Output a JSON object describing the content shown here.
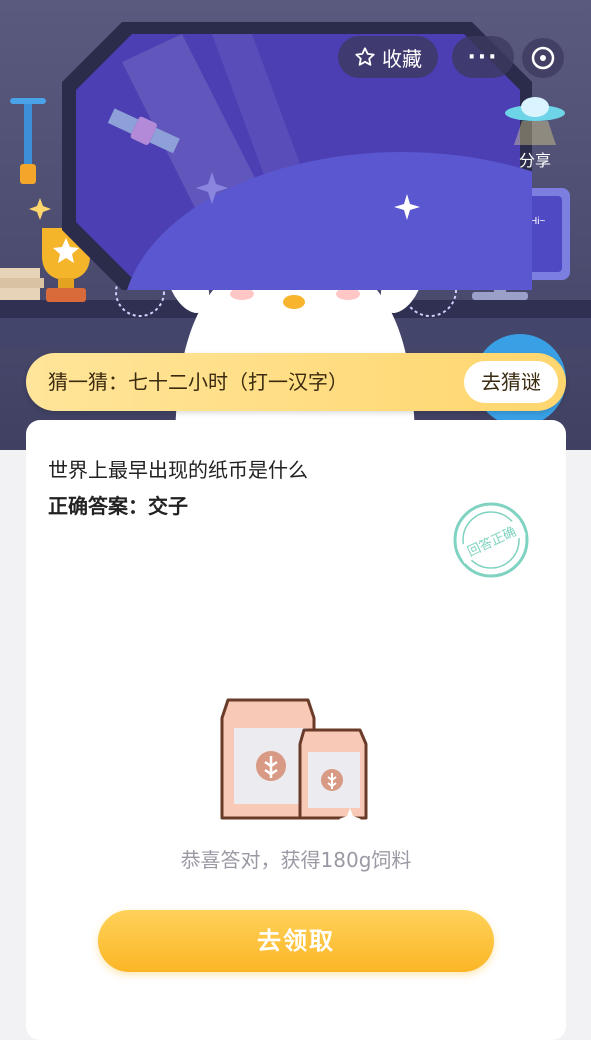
{
  "header": {
    "favorite_label": "收藏",
    "more_label": "···",
    "share_label": "分享",
    "icons": {
      "favorite": "star-icon",
      "more": "more-icon",
      "close": "close-icon",
      "share": "ufo-share-icon"
    }
  },
  "scene": {
    "monitor_greeting": "Hi~"
  },
  "riddle": {
    "text": "猜一猜：七十二小时（打一汉字）",
    "button_label": "去猜谜"
  },
  "quiz": {
    "question": "世界上最早出现的纸币是什么",
    "answer": "正确答案：交子",
    "stamp_text": "回答正确"
  },
  "reward": {
    "message": "恭喜答对，获得180g饲料",
    "claim_label": "去领取"
  },
  "colors": {
    "accent_yellow": "#fbb626",
    "hero_background": "#4c4d70",
    "window_purple": "#4b3fb3",
    "stamp_green": "#7fd3c0"
  }
}
